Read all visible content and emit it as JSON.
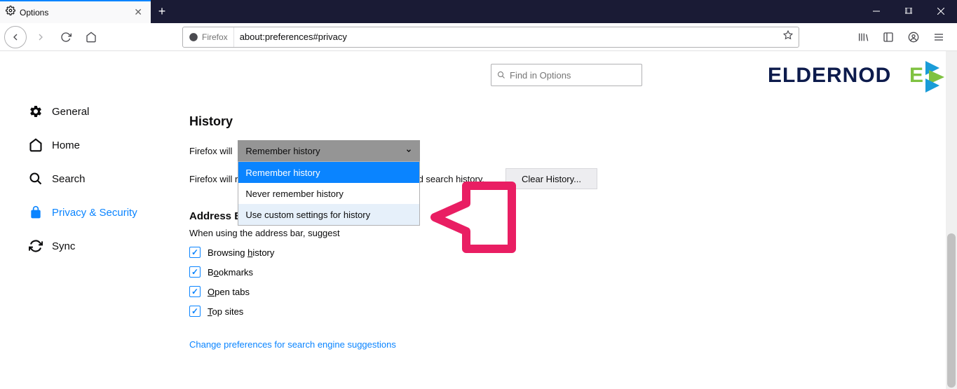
{
  "tab": {
    "title": "Options"
  },
  "url": {
    "prefix_label": "Firefox",
    "value": "about:preferences#privacy"
  },
  "search": {
    "placeholder": "Find in Options"
  },
  "sidebar": {
    "items": [
      {
        "label": "General"
      },
      {
        "label": "Home"
      },
      {
        "label": "Search"
      },
      {
        "label": "Privacy & Security"
      },
      {
        "label": "Sync"
      }
    ]
  },
  "history": {
    "title": "History",
    "prefix": "Firefox will",
    "selected": "Remember history",
    "options": [
      "Remember history",
      "Never remember history",
      "Use custom settings for history"
    ],
    "desc_prefix": "Firefox will r",
    "desc_suffix": "m, and search history.",
    "clear_button": "Clear History..."
  },
  "addressbar": {
    "title": "Address Bar",
    "desc": "When using the address bar, suggest",
    "opts": [
      {
        "pre": "Browsing ",
        "hot": "h",
        "post": "istory"
      },
      {
        "pre": "B",
        "hot": "o",
        "post": "okmarks"
      },
      {
        "pre": "",
        "hot": "O",
        "post": "pen tabs"
      },
      {
        "pre": "",
        "hot": "T",
        "post": "op sites"
      }
    ],
    "link": "Change preferences for search engine suggestions"
  },
  "logo_text": "ELDERNODE"
}
